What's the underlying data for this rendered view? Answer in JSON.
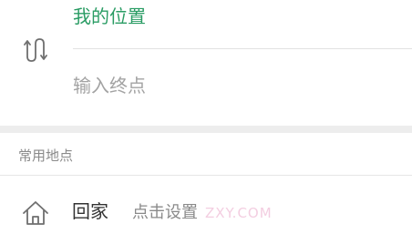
{
  "route": {
    "start_label": "我的位置",
    "end_placeholder": "输入终点",
    "swap_icon": "swap-route-icon"
  },
  "places": {
    "section_title": "常用地点",
    "home": {
      "label": "回家",
      "action": "点击设置",
      "icon": "home-icon"
    },
    "watermark": "ZXY.COM"
  },
  "colors": {
    "start_text": "#2a9c64",
    "placeholder_text": "#a3a3a3",
    "background": "#ededed"
  }
}
